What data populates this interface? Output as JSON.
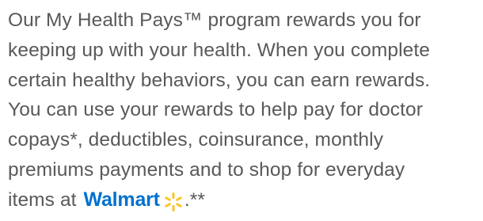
{
  "paragraph": {
    "lines": [
      "Our My Health Pays™ program rewards you for",
      "keeping up with your health. When you complete",
      "certain healthy behaviors, you can earn rewards.",
      "You can use your rewards to help pay for doctor",
      "copays*, deductibles, coinsurance, monthly",
      "premiums payments and to shop for everyday"
    ],
    "last_line_prefix": "items at",
    "last_line_suffix": ".**"
  },
  "logo": {
    "word": "Walmart",
    "icon": "walmart-spark-icon",
    "word_color": "#0071ce",
    "spark_color": "#ffc220"
  },
  "colors": {
    "text": "#595959",
    "background": "#ffffff"
  }
}
